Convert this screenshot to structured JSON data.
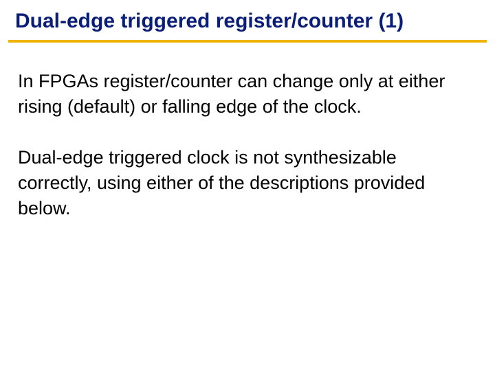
{
  "title": "Dual-edge triggered register/counter (1)",
  "paragraphs": {
    "p1": "In FPGAs register/counter can change only at either rising (default) or falling edge of the clock.",
    "p2": "Dual-edge triggered clock is not synthesizable correctly, using either of the descriptions provided below."
  }
}
